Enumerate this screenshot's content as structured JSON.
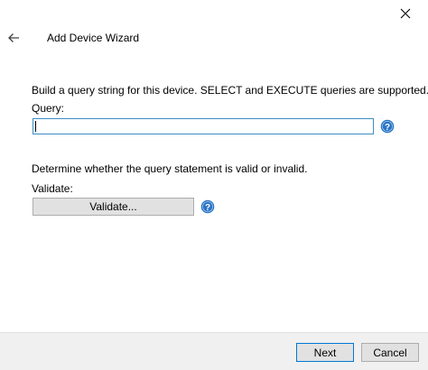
{
  "window": {
    "title": "Add Device Wizard",
    "close_icon": "close-icon",
    "back_icon": "back-arrow-icon"
  },
  "query_section": {
    "instruction": "Build a query string for this device. SELECT and EXECUTE queries are supported.",
    "label": "Query:",
    "value": "",
    "help_icon": "help-icon"
  },
  "validate_section": {
    "instruction": "Determine whether the query statement is valid or invalid.",
    "label": "Validate:",
    "button_label": "Validate...",
    "help_icon": "help-icon"
  },
  "footer": {
    "next_label": "Next",
    "cancel_label": "Cancel"
  },
  "colors": {
    "accent": "#0078d7",
    "input_border": "#3c8ec7",
    "help_icon": "#2a73c4"
  }
}
